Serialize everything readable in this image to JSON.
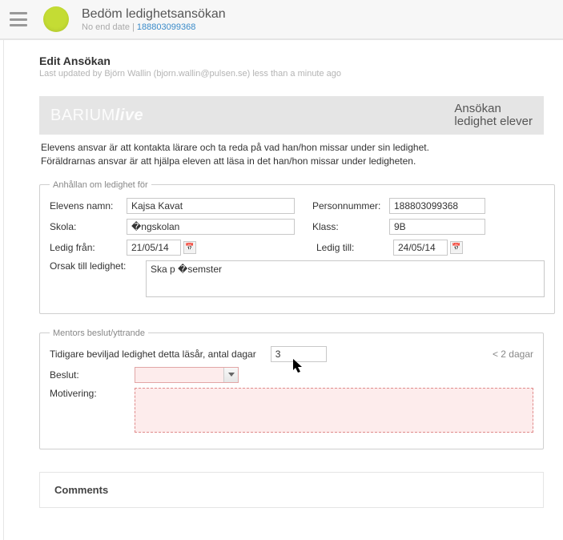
{
  "topbar": {
    "title": "Bedöm ledighetsansökan",
    "sub_prefix": "No end date | ",
    "sub_link": "188803099368"
  },
  "edit": {
    "heading": "Edit Ansökan",
    "sub": "Last updated by Björn Wallin (bjorn.wallin@pulsen.se) less than a minute ago"
  },
  "brand": {
    "logo_a": "BARIUM",
    "logo_b": "live",
    "right1": "Ansökan",
    "right2": "ledighet elever"
  },
  "intro": {
    "line1": "Elevens ansvar är att kontakta lärare och ta reda på vad han/hon missar under sin ledighet.",
    "line2": "Föräldrarnas ansvar är att hjälpa eleven att läsa in det han/hon missar under ledigheten."
  },
  "fs1": {
    "legend": "Anhållan om ledighet för",
    "labels": {
      "name": "Elevens namn:",
      "pnr": "Personnummer:",
      "school": "Skola:",
      "klass": "Klass:",
      "from": "Ledig från:",
      "to": "Ledig till:",
      "reason": "Orsak till ledighet:"
    },
    "values": {
      "name": "Kajsa Kavat",
      "pnr": "188803099368",
      "school": "�ngskolan",
      "klass": "9B",
      "from": "21/05/14",
      "to": "24/05/14",
      "reason": "Ska p �semster"
    }
  },
  "fs2": {
    "legend": "Mentors beslut/yttrande",
    "prev_label": "Tidigare beviljad ledighet detta läsår, antal dagar",
    "prev_value": "3",
    "days_note": "< 2 dagar",
    "decision_label": "Beslut:",
    "motivation_label": "Motivering:"
  },
  "comments": {
    "heading": "Comments"
  }
}
